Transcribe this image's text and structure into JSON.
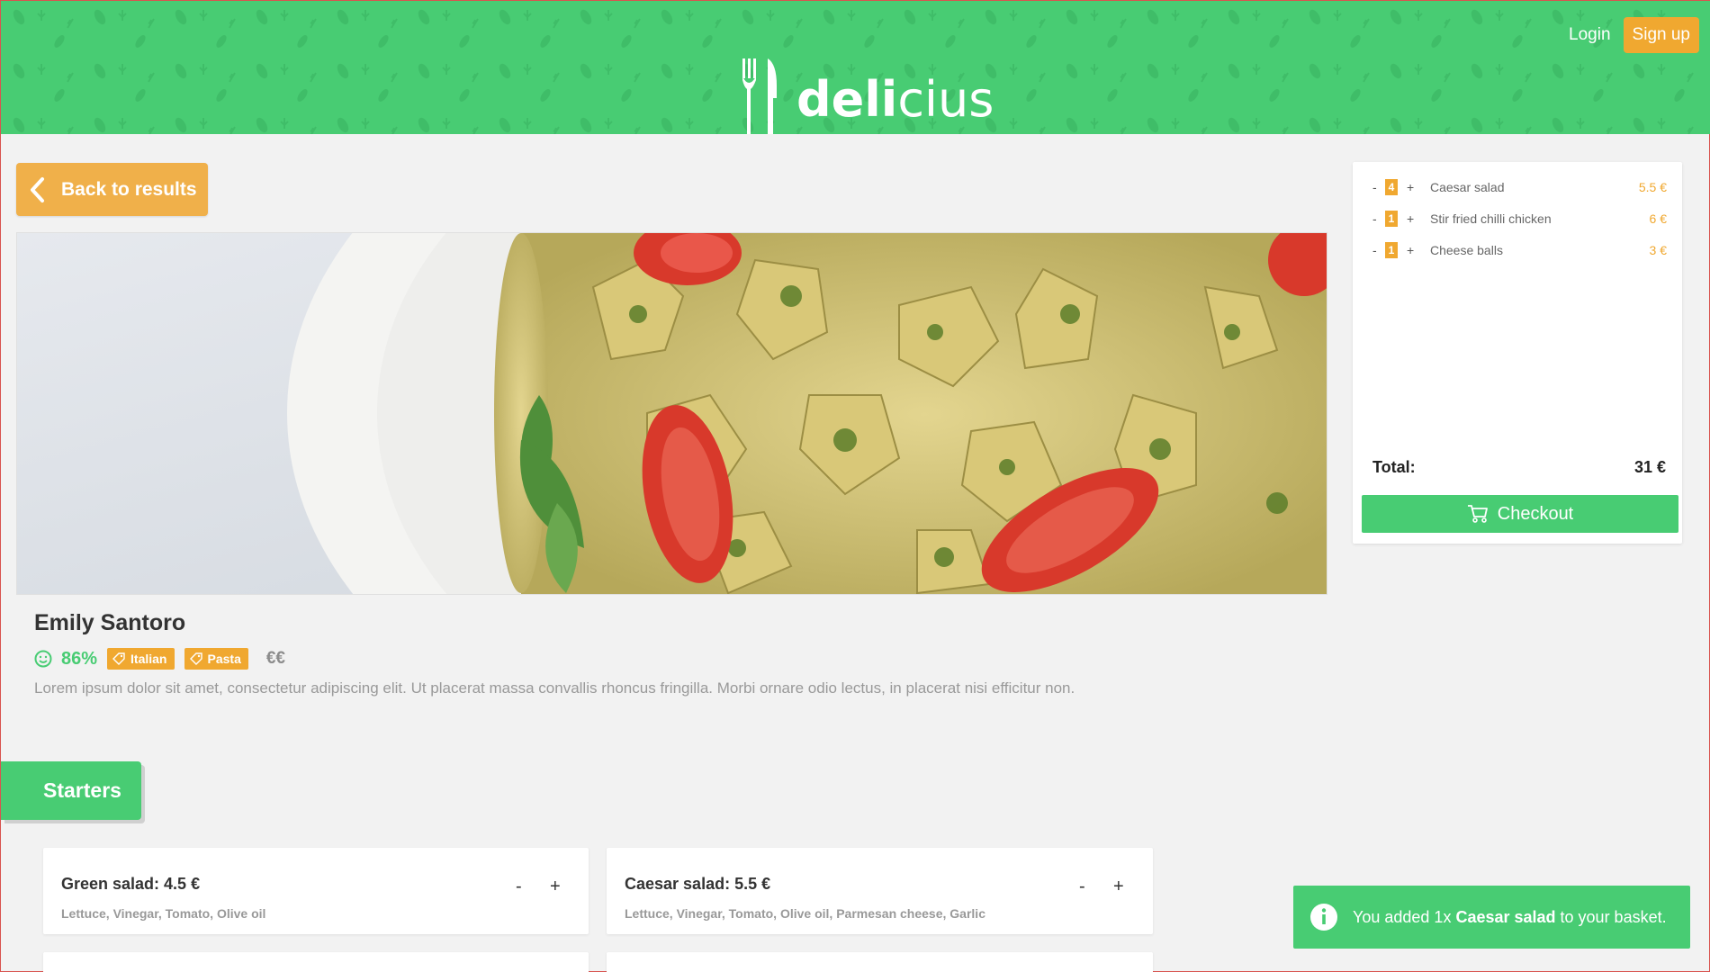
{
  "header": {
    "logo_bold": "deli",
    "logo_light": "cius",
    "login_label": "Login",
    "signup_label": "Sign up"
  },
  "nav": {
    "back_label": "Back to results"
  },
  "restaurant": {
    "name": "Emily Santoro",
    "rating": "86%",
    "tags": [
      "Italian",
      "Pasta"
    ],
    "price_level": "€€",
    "description": "Lorem ipsum dolor sit amet, consectetur adipiscing elit. Ut placerat massa convallis rhoncus fringilla. Morbi ornare odio lectus, in placerat nisi efficitur non."
  },
  "section": {
    "title": "Starters"
  },
  "menu_items": [
    {
      "title": "Green salad: 4.5 €",
      "ingredients": "Lettuce, Vinegar, Tomato, Olive oil",
      "minus": "-",
      "plus": "+"
    },
    {
      "title": "Caesar salad: 5.5 €",
      "ingredients": "Lettuce, Vinegar, Tomato, Olive oil, Parmesan cheese, Garlic",
      "minus": "-",
      "plus": "+"
    }
  ],
  "basket": {
    "items": [
      {
        "minus": "-",
        "count": "4",
        "plus": "+",
        "name": "Caesar salad",
        "price": "5.5 €"
      },
      {
        "minus": "-",
        "count": "1",
        "plus": "+",
        "name": "Stir fried chilli chicken",
        "price": "6 €"
      },
      {
        "minus": "-",
        "count": "1",
        "plus": "+",
        "name": "Cheese balls",
        "price": "3 €"
      }
    ],
    "total_label": "Total:",
    "total_value": "31 €",
    "checkout_label": "Checkout"
  },
  "toast": {
    "prefix": "You added 1x",
    "item": "Caesar salad",
    "suffix": "to your basket."
  },
  "colors": {
    "brand_green": "#48cc73",
    "accent_orange": "#f0a830",
    "back_button": "#f0b04a"
  },
  "icons": {
    "logo": "fork-knife-icon",
    "back": "chevron-left-icon",
    "rating": "smiley-icon",
    "tag": "tag-icon",
    "checkout": "cart-icon",
    "toast": "info-icon"
  }
}
